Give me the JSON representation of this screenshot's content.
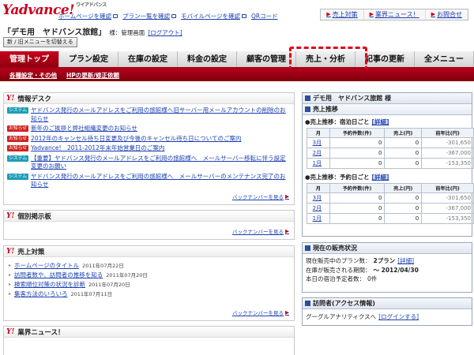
{
  "brand": {
    "logo": "Yadvance!",
    "logo_tm": "ワイアドバンス"
  },
  "toplinks": [
    {
      "label": "ホームページを確認"
    },
    {
      "label": "プラン一覧を確認"
    },
    {
      "label": "モバイルページを確認"
    },
    {
      "label": "QRコード"
    }
  ],
  "righttabs": [
    {
      "label": "売上対策"
    },
    {
      "label": "業界ニュース！"
    },
    {
      "label": "お問合せ"
    }
  ],
  "account": {
    "inn": "「デモ用　ヤドバンス旅館」",
    "subtitle": "様：管理画面",
    "logout": "[ログアウト]",
    "old_menu_button": "新 / 旧メニューを切替える"
  },
  "mainnav": [
    {
      "label": "管理トップ"
    },
    {
      "label": "プラン設定"
    },
    {
      "label": "在庫の設定"
    },
    {
      "label": "料金の設定"
    },
    {
      "label": "顧客の管理"
    },
    {
      "label": "売上・分析"
    },
    {
      "label": "記事の更新"
    },
    {
      "label": "全メニュー"
    }
  ],
  "subnav": [
    {
      "label": "各種設定・その他"
    },
    {
      "label": "HPの更新/修正依頼"
    }
  ],
  "info_desk": {
    "title": "情報デスク",
    "items": [
      {
        "badge": "システム",
        "kind": "sys",
        "text": "ヤドバンス発行のメールアドレスをご利用の旅館様へ旧サーバー用メールアカウントの削除のお知らせ"
      },
      {
        "badge": "お知らせ",
        "kind": "info",
        "text": "新年のご挨拶と弊社組織変更のお知らせ"
      },
      {
        "badge": "お知らせ",
        "kind": "info",
        "text": "2012年のキャンセル待ち日変更及び今後のキャンセル待ち日についてのご案内"
      },
      {
        "badge": "お知らせ",
        "kind": "info",
        "text": "Yadvance!　2011-2012年末年始営業日のご案内"
      },
      {
        "badge": "システム",
        "kind": "sys",
        "text": "【重要】ヤドバンス発行のメールアドレスをご利用の旅館様へ　メールサーバー移転に伴う設定変更のお願い"
      },
      {
        "badge": "システム",
        "kind": "sys",
        "text": "ヤドバンス発行のメールアドレスをご利用の旅館様へ　メールサーバーのメンテナンス完了のお知らせ"
      }
    ],
    "back": "バックナンバーを見る"
  },
  "bulletin": {
    "title": "個別掲示板",
    "back": "バックナンバーを見る"
  },
  "sales_measures": {
    "title": "売上対策",
    "items": [
      {
        "text": "ホームページのタイトル",
        "date": "2011年07月22日"
      },
      {
        "text": "訪問者数や、訪問者の推移を知る",
        "date": "2011年07月20日"
      },
      {
        "text": "検索順位対策の状況を診断",
        "date": "2011年07月20日"
      },
      {
        "text": "集客方法のいろいろ",
        "date": "2011年07月11日"
      }
    ],
    "back": "バックナンバーを見る"
  },
  "industry_news": {
    "title": "業界ニュース！"
  },
  "right": {
    "header": "デモ用　ヤドバンス旅館 様",
    "sales_title": "売上推移",
    "by_stay": {
      "label": "●売上推移：宿泊日ごと",
      "detail": "[詳細]"
    },
    "by_booking": {
      "label": "●売上推移：予約日ごと",
      "detail": "[詳細]"
    },
    "cols": [
      "月",
      "予約件数(件)",
      "売上(円)",
      "前年比(円)"
    ],
    "stay_rows": [
      {
        "month": "3月",
        "count": "0",
        "sales": "0",
        "yoy": "-301,650"
      },
      {
        "month": "2月",
        "count": "0",
        "sales": "0",
        "yoy": "-367,000"
      },
      {
        "month": "1月",
        "count": "0",
        "sales": "0",
        "yoy": "-153,350"
      }
    ],
    "booking_rows": [
      {
        "month": "3月",
        "count": "0",
        "sales": "0",
        "yoy": "-301,650"
      },
      {
        "month": "2月",
        "count": "0",
        "sales": "0",
        "yoy": "-367,000"
      },
      {
        "month": "1月",
        "count": "0",
        "sales": "0",
        "yoy": "-153,350"
      }
    ],
    "status_title": "現在の販売状況",
    "status_lines": [
      {
        "text": "現在販売中のプラン数：",
        "value": "2プラン",
        "link": "[詳細]"
      },
      {
        "text": "在庫が販売される期間：",
        "value": "～ 2012/04/30",
        "link": ""
      },
      {
        "text": "本日の宿泊予定者数：",
        "value": "0件",
        "link": ""
      }
    ],
    "visitors_title": "訪問者(アクセス情報)",
    "visitors_text": "グーグルアナリティクスへ",
    "visitors_link": "[ログインする]"
  }
}
